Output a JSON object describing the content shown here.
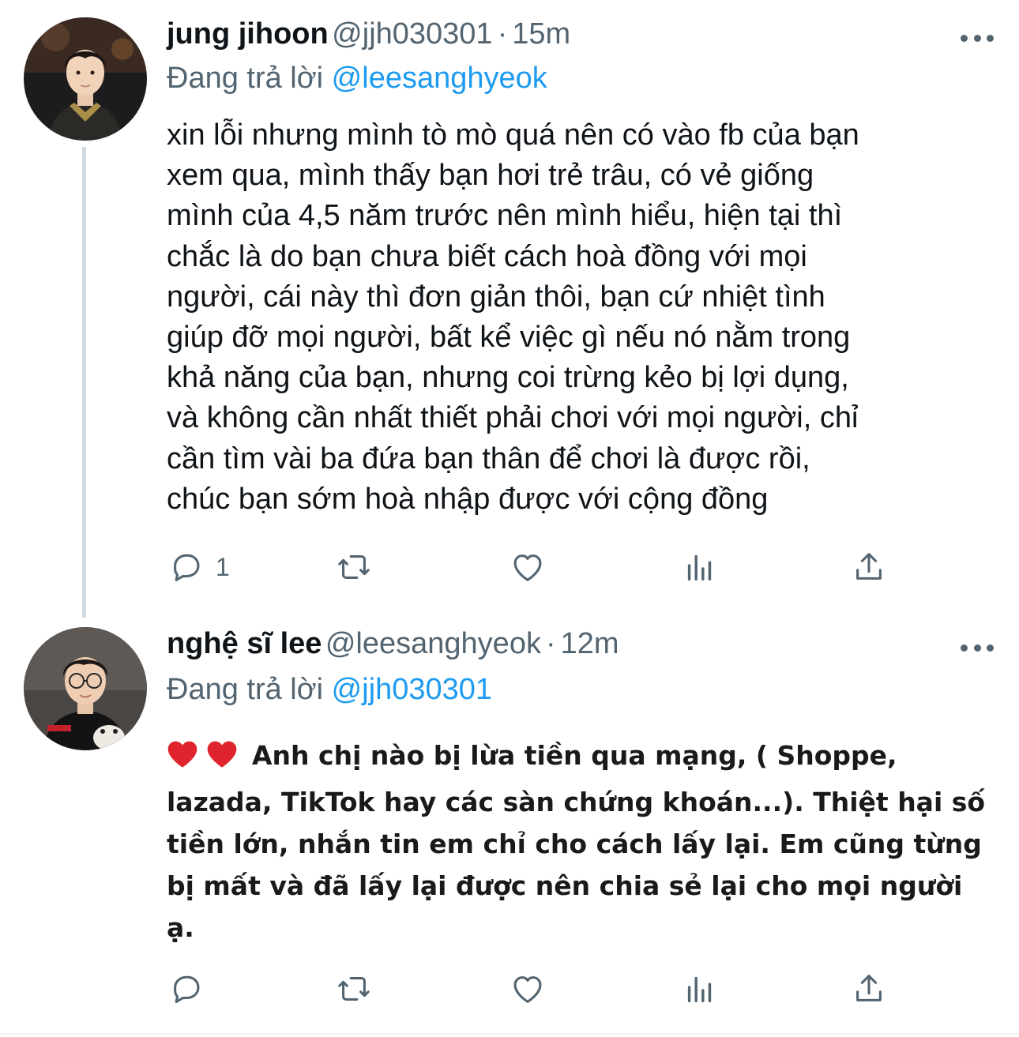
{
  "tweets": [
    {
      "display_name": "jung jihoon",
      "handle": "@jjh030301",
      "separator": "·",
      "time": "15m",
      "replying_label": "Đang trả lời",
      "replying_to": "@leesanghyeok",
      "avatar_icon": "avatar-photo-jung-jihoon",
      "body_lines": [
        "xin lỗi nhưng mình tò mò quá nên có vào fb của bạn",
        "xem qua, mình thấy bạn hơi trẻ trâu, có vẻ giống",
        "mình của 4,5 năm trước nên mình hiểu, hiện tại thì",
        "chắc là do bạn chưa biết cách hoà đồng với mọi",
        "người, cái này thì đơn giản thôi, bạn cứ nhiệt tình",
        "giúp đỡ mọi người, bất kể việc gì nếu nó nằm trong",
        "khả năng của bạn, nhưng coi trừng kẻo bị lợi dụng,",
        "và không cần nhất thiết phải chơi với mọi người, chỉ",
        "cần tìm vài ba đứa bạn thân để chơi là được rồi,",
        "chúc bạn sớm hoà nhập được với cộng đồng"
      ],
      "actions": {
        "reply_count": "1"
      }
    },
    {
      "display_name": "nghệ sĩ lee",
      "handle": "@leesanghyeok",
      "separator": "·",
      "time": "12m",
      "replying_label": "Đang trả lời",
      "replying_to": "@jjh030301",
      "avatar_icon": "avatar-photo-nghe-si-lee",
      "body_lines": [
        "Anh chị nào bị lừa tiền qua mạng, ( Shoppe,",
        "lazada, TikTok hay các sàn chứng khoán...). Thiệt hại số",
        "tiền lớn, nhắn tin em chỉ cho cách lấy lại. Em cũng từng",
        "bị mất và đã lấy lại được nên chia sẻ lại cho mọi người",
        "ạ."
      ],
      "emoji_prefix": [
        "red-heart-icon",
        "red-heart-icon"
      ],
      "actions": {
        "reply_count": ""
      }
    }
  ],
  "colors": {
    "text_primary": "#0f1419",
    "text_secondary": "#536471",
    "link": "#1d9bf0",
    "thread_line": "#cfd9de",
    "heart_emoji": "#e0242e"
  },
  "icons": {
    "reply": "reply-bubble-icon",
    "retweet": "retweet-icon",
    "like": "heart-outline-icon",
    "stats": "analytics-bars-icon",
    "share": "share-upload-icon",
    "more": "more-dots-icon"
  }
}
